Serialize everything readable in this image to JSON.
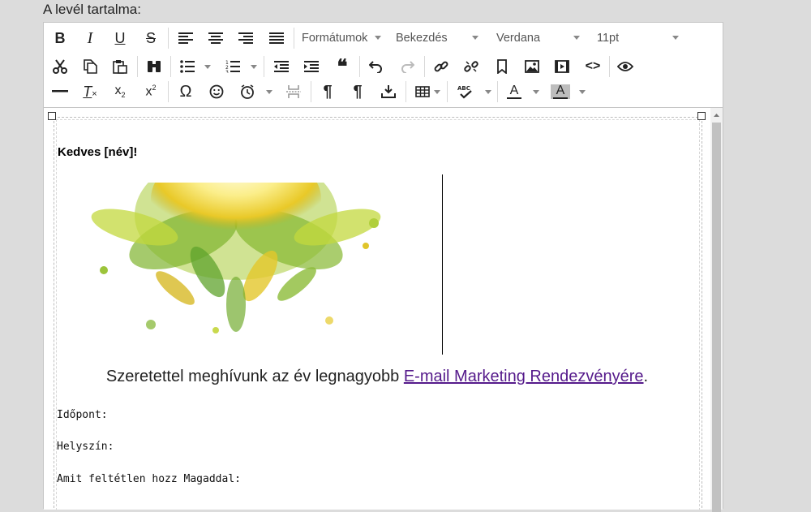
{
  "section_label": "A levél tartalma:",
  "toolbar": {
    "row1": [
      "bold-icon",
      "italic-icon",
      "underline-icon",
      "strikethrough-icon",
      "align-left-icon",
      "align-center-icon",
      "align-right-icon",
      "align-justify-icon"
    ],
    "formats_label": "Formátumok",
    "block_label": "Bekezdés",
    "font_family": "Verdana",
    "font_size": "11pt",
    "row2": [
      "cut-icon",
      "copy-icon",
      "paste-icon",
      "find-replace-icon",
      "bullet-list-icon",
      "numbered-list-icon",
      "outdent-icon",
      "indent-icon",
      "blockquote-icon",
      "undo-icon",
      "redo-icon",
      "link-icon",
      "unlink-icon",
      "bookmark-icon",
      "image-icon",
      "media-icon",
      "code-icon",
      "preview-icon"
    ],
    "row3": [
      "horizontal-rule-icon",
      "clear-format-icon",
      "subscript-icon",
      "superscript-icon",
      "special-char-icon",
      "emoticon-icon",
      "insert-time-icon",
      "page-break-icon",
      "paragraph-mark-icon",
      "show-blocks-icon",
      "template-icon",
      "table-icon",
      "spellcheck-icon",
      "text-color-icon",
      "background-color-icon"
    ],
    "subscript_glyph": "x",
    "superscript_glyph": "x",
    "omega_glyph": "Ω",
    "quote_glyph": "❝",
    "code_glyph": "<>",
    "pilcrow_glyph": "¶",
    "text_color_glyph": "A",
    "bg_color_glyph": "A",
    "bold_glyph": "B",
    "italic_glyph": "I",
    "underline_glyph": "U",
    "strike_glyph": "S",
    "tx_glyph": "T"
  },
  "colors": {
    "link": "#551a8b",
    "text_color_bar": "#222222",
    "bg_color_swatch": "#bdbdbd"
  },
  "content": {
    "greeting": "Kedves [név]!",
    "invite_text": "Szeretettel meghívunk az év legnagyobb ",
    "invite_link": "E-mail Marketing Rendezvényére",
    "invite_end": ".",
    "fields": [
      "Időpont:",
      "Helyszín:",
      "Amit feltétlen hozz Magaddal:"
    ]
  }
}
